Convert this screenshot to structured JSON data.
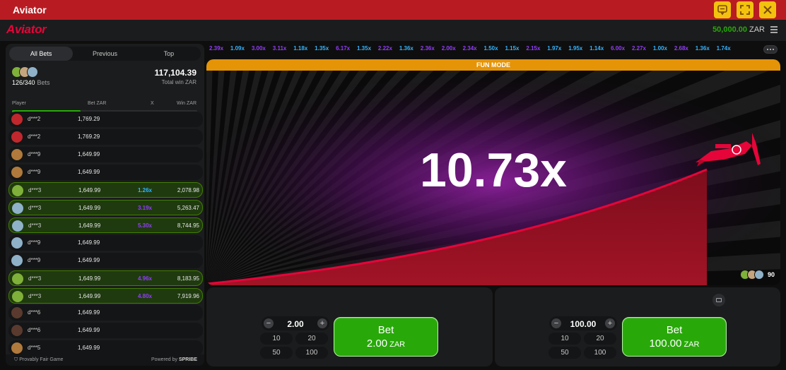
{
  "window": {
    "title": "Aviator"
  },
  "app": {
    "logo": "Aviator",
    "balance": "50,000.00",
    "currency": "ZAR"
  },
  "tabs": [
    {
      "label": "All Bets",
      "active": true
    },
    {
      "label": "Previous",
      "active": false
    },
    {
      "label": "Top",
      "active": false
    }
  ],
  "summary": {
    "bets": "126/340",
    "bets_label": "Bets",
    "total_win": "117,104.39",
    "total_win_label": "Total win ZAR",
    "progress_fraction": 0.37
  },
  "columns": {
    "player": "Player",
    "bet": "Bet ZAR",
    "x": "X",
    "win": "Win ZAR"
  },
  "rows": [
    {
      "name": "d***2",
      "bet": "1,769.29",
      "x": "",
      "win": "",
      "avatar": "#c0282d",
      "won": false,
      "xcolor": ""
    },
    {
      "name": "d***2",
      "bet": "1,769.29",
      "x": "",
      "win": "",
      "avatar": "#c0282d",
      "won": false,
      "xcolor": ""
    },
    {
      "name": "d***9",
      "bet": "1,649.99",
      "x": "",
      "win": "",
      "avatar": "#b07a3c",
      "won": false,
      "xcolor": ""
    },
    {
      "name": "d***9",
      "bet": "1,649.99",
      "x": "",
      "win": "",
      "avatar": "#b07a3c",
      "won": false,
      "xcolor": ""
    },
    {
      "name": "d***3",
      "bet": "1,649.99",
      "x": "1.26x",
      "win": "2,078.98",
      "avatar": "#7fb03a",
      "won": true,
      "xcolor": "#34b4ff"
    },
    {
      "name": "d***3",
      "bet": "1,649.99",
      "x": "3.19x",
      "win": "5,263.47",
      "avatar": "#8fb2c9",
      "won": true,
      "xcolor": "#913ef8"
    },
    {
      "name": "d***3",
      "bet": "1,649.99",
      "x": "5.30x",
      "win": "8,744.95",
      "avatar": "#8fb2c9",
      "won": true,
      "xcolor": "#913ef8"
    },
    {
      "name": "d***9",
      "bet": "1,649.99",
      "x": "",
      "win": "",
      "avatar": "#8fb2c9",
      "won": false,
      "xcolor": ""
    },
    {
      "name": "d***9",
      "bet": "1,649.99",
      "x": "",
      "win": "",
      "avatar": "#8fb2c9",
      "won": false,
      "xcolor": ""
    },
    {
      "name": "d***3",
      "bet": "1,649.99",
      "x": "4.96x",
      "win": "8,183.95",
      "avatar": "#7fb03a",
      "won": true,
      "xcolor": "#913ef8"
    },
    {
      "name": "d***3",
      "bet": "1,649.99",
      "x": "4.80x",
      "win": "7,919.96",
      "avatar": "#7fb03a",
      "won": true,
      "xcolor": "#913ef8"
    },
    {
      "name": "d***6",
      "bet": "1,649.99",
      "x": "",
      "win": "",
      "avatar": "#5a3a2e",
      "won": false,
      "xcolor": ""
    },
    {
      "name": "d***6",
      "bet": "1,649.99",
      "x": "",
      "win": "",
      "avatar": "#5a3a2e",
      "won": false,
      "xcolor": ""
    },
    {
      "name": "d***5",
      "bet": "1,649.99",
      "x": "",
      "win": "",
      "avatar": "#b07a3c",
      "won": false,
      "xcolor": ""
    }
  ],
  "footer": {
    "provably_fair": "Provably Fair Game",
    "powered_by": "Powered by",
    "brand": "SPRIBE"
  },
  "history": [
    {
      "v": "2.39x",
      "c": "#913ef8"
    },
    {
      "v": "1.09x",
      "c": "#34b4ff"
    },
    {
      "v": "3.00x",
      "c": "#913ef8"
    },
    {
      "v": "3.11x",
      "c": "#913ef8"
    },
    {
      "v": "1.18x",
      "c": "#34b4ff"
    },
    {
      "v": "1.35x",
      "c": "#34b4ff"
    },
    {
      "v": "6.17x",
      "c": "#913ef8"
    },
    {
      "v": "1.35x",
      "c": "#34b4ff"
    },
    {
      "v": "2.22x",
      "c": "#913ef8"
    },
    {
      "v": "1.36x",
      "c": "#34b4ff"
    },
    {
      "v": "2.36x",
      "c": "#913ef8"
    },
    {
      "v": "2.00x",
      "c": "#913ef8"
    },
    {
      "v": "2.34x",
      "c": "#913ef8"
    },
    {
      "v": "1.50x",
      "c": "#34b4ff"
    },
    {
      "v": "1.15x",
      "c": "#34b4ff"
    },
    {
      "v": "2.15x",
      "c": "#913ef8"
    },
    {
      "v": "1.97x",
      "c": "#34b4ff"
    },
    {
      "v": "1.95x",
      "c": "#34b4ff"
    },
    {
      "v": "1.14x",
      "c": "#34b4ff"
    },
    {
      "v": "6.00x",
      "c": "#913ef8"
    },
    {
      "v": "2.27x",
      "c": "#913ef8"
    },
    {
      "v": "1.00x",
      "c": "#34b4ff"
    },
    {
      "v": "2.68x",
      "c": "#913ef8"
    },
    {
      "v": "1.36x",
      "c": "#34b4ff"
    },
    {
      "v": "1.74x",
      "c": "#34b4ff"
    }
  ],
  "game": {
    "mode": "FUN MODE",
    "multiplier": "10.73x",
    "players_online": "90",
    "accent": "#e50539"
  },
  "bet1": {
    "amount": "2.00",
    "quick": [
      "10",
      "20",
      "50",
      "100"
    ],
    "button_label": "Bet",
    "button_amount": "2.00",
    "currency": "ZAR"
  },
  "bet2": {
    "amount": "100.00",
    "quick": [
      "10",
      "20",
      "50",
      "100"
    ],
    "button_label": "Bet",
    "button_amount": "100.00",
    "currency": "ZAR"
  },
  "icons": [
    "chat-icon",
    "fullscreen-icon",
    "close-icon",
    "menu-icon",
    "shield-icon",
    "more-icon",
    "plane-icon"
  ]
}
